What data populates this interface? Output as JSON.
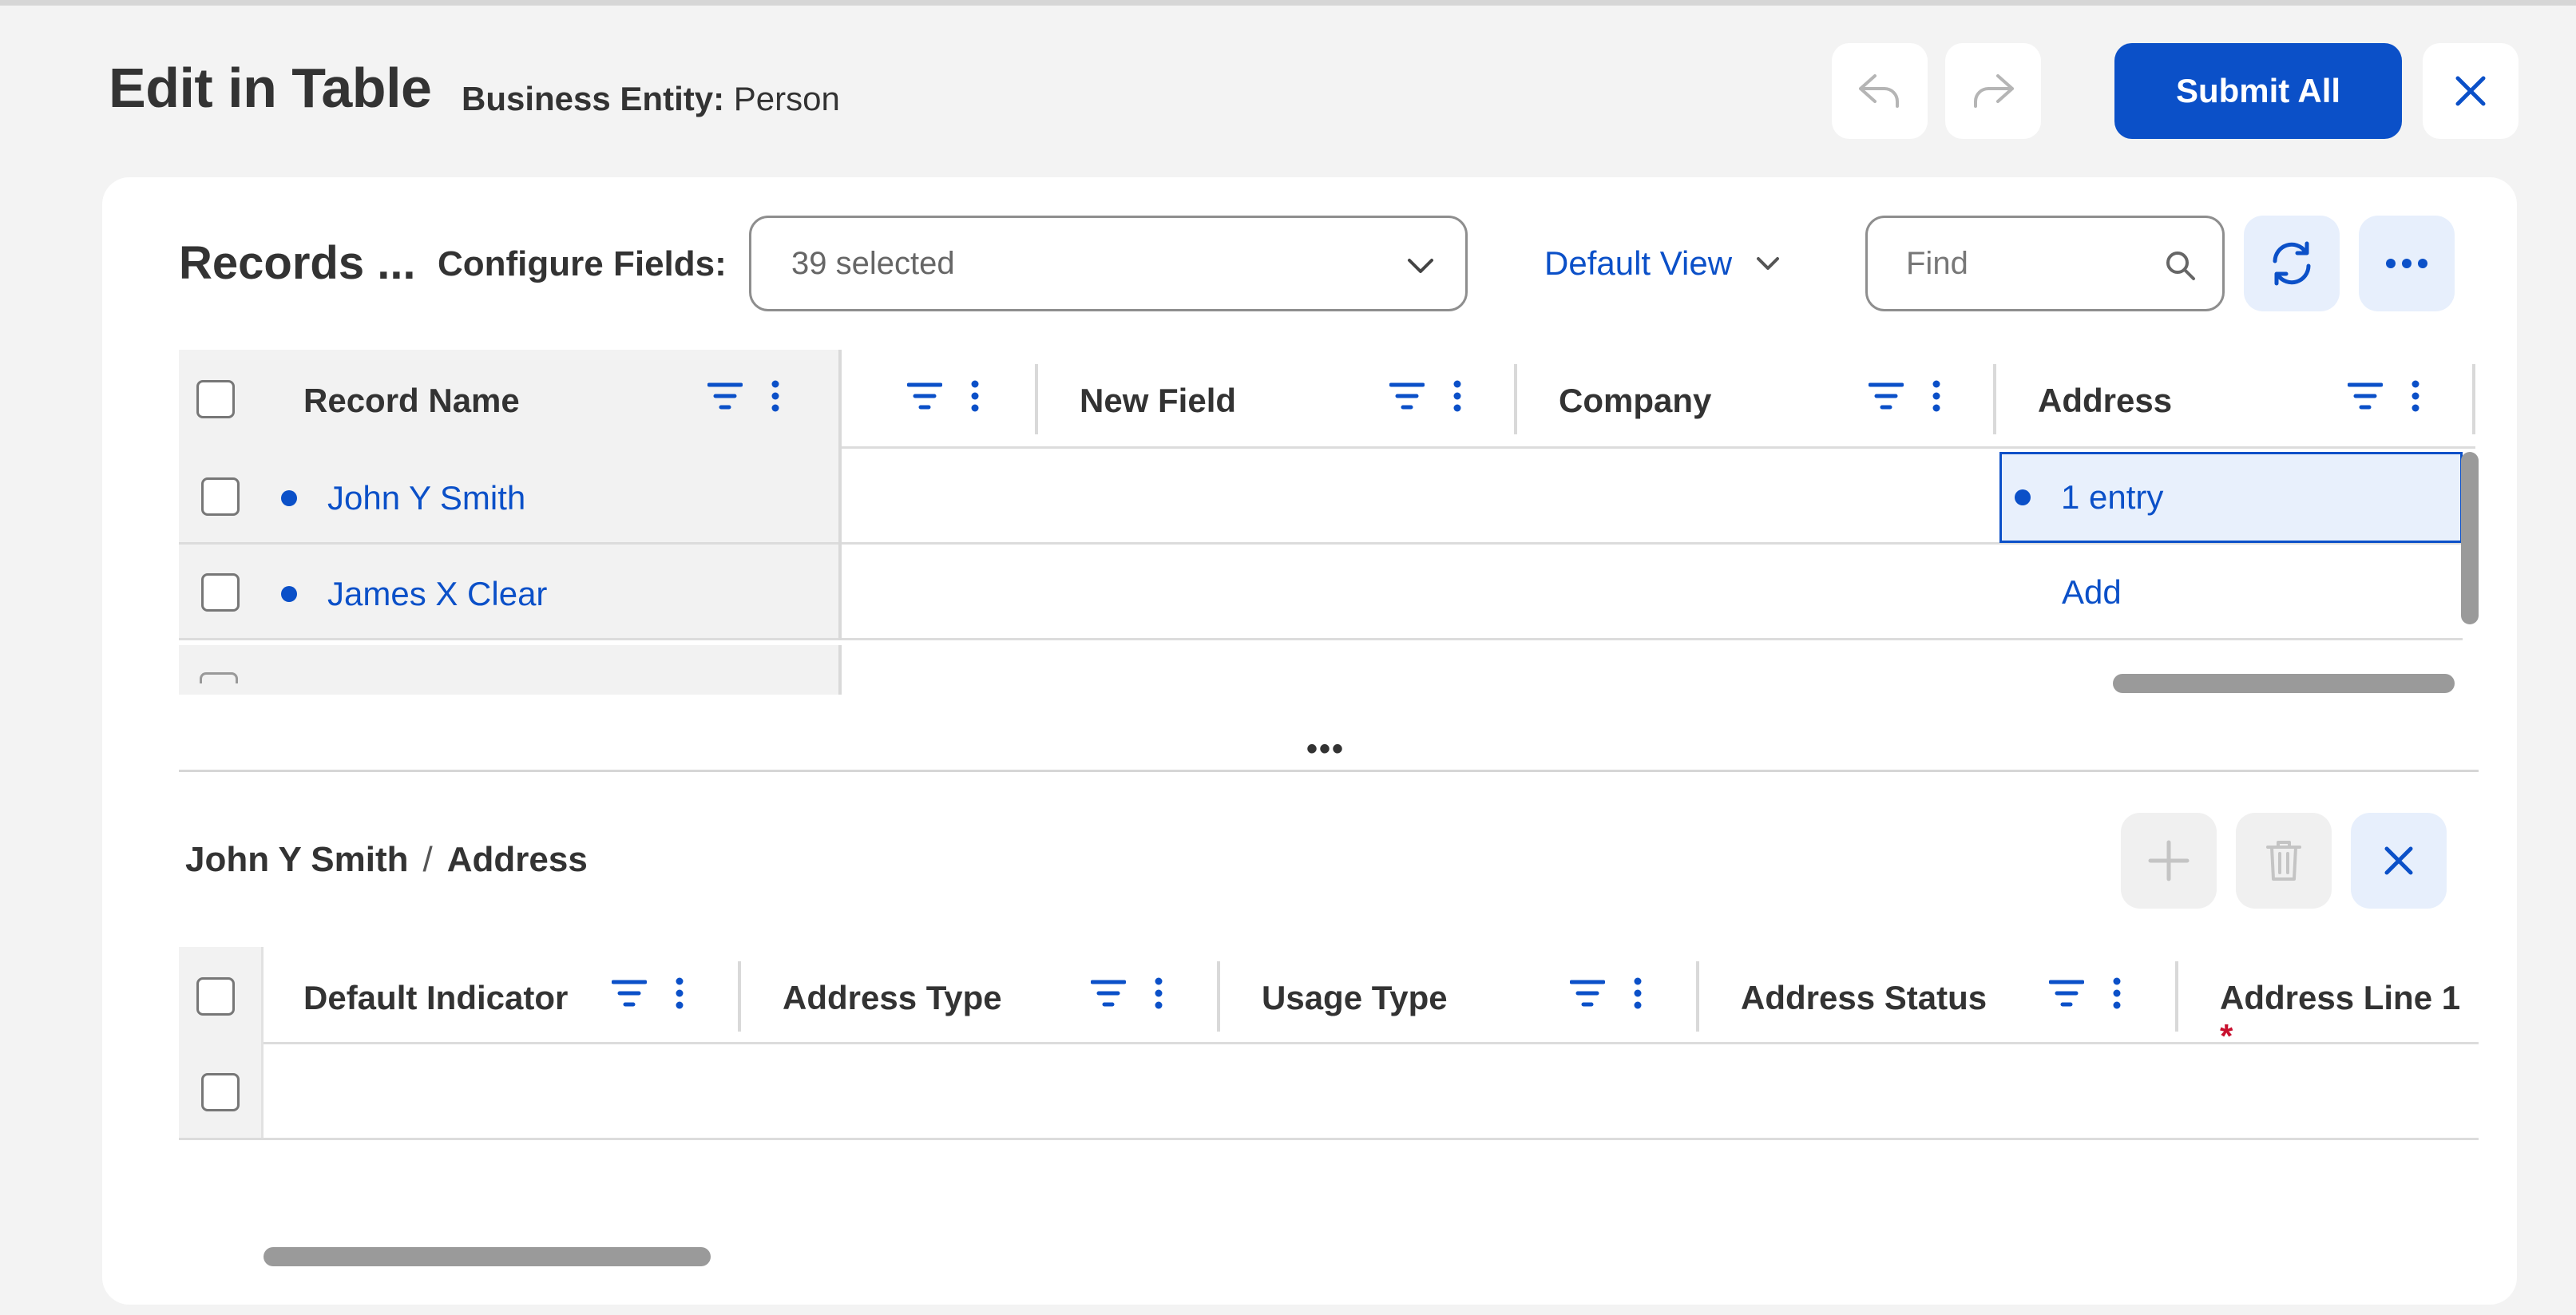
{
  "header": {
    "title": "Edit in Table",
    "entity_label": "Business Entity:",
    "entity_value": "Person",
    "submit_label": "Submit All",
    "icons": {
      "undo": "undo-arrow-icon",
      "redo": "redo-arrow-icon",
      "close": "close-icon"
    }
  },
  "toolbar": {
    "records_title": "Records ...",
    "configure_label": "Configure Fields:",
    "configure_value": "39 selected",
    "view_label": "Default View",
    "find_placeholder": "Find",
    "icons": {
      "refresh": "refresh-icon",
      "more": "more-horizontal-icon"
    }
  },
  "records_grid": {
    "columns": [
      {
        "label": "Record Name"
      },
      {
        "label": ""
      },
      {
        "label": "New Field"
      },
      {
        "label": "Company"
      },
      {
        "label": "Address"
      }
    ],
    "rows": [
      {
        "name": "John Y Smith",
        "address": "1 entry"
      },
      {
        "name": "James X Clear",
        "address": "Add"
      }
    ]
  },
  "splitter": {
    "label": "•••"
  },
  "detail": {
    "breadcrumb": {
      "record": "John Y Smith",
      "separator": "/",
      "field": "Address"
    },
    "columns": [
      {
        "label": "Default Indicator"
      },
      {
        "label": "Address Type"
      },
      {
        "label": "Usage Type"
      },
      {
        "label": "Address Status"
      },
      {
        "label": "Address Line 1",
        "required": "*"
      }
    ],
    "icons": {
      "add": "plus-icon",
      "delete": "trash-icon",
      "close": "close-icon"
    }
  },
  "colors": {
    "accent": "#0b50c8",
    "accent_light": "#e7effc",
    "background": "#f3f3f3",
    "required": "#c8102e"
  }
}
